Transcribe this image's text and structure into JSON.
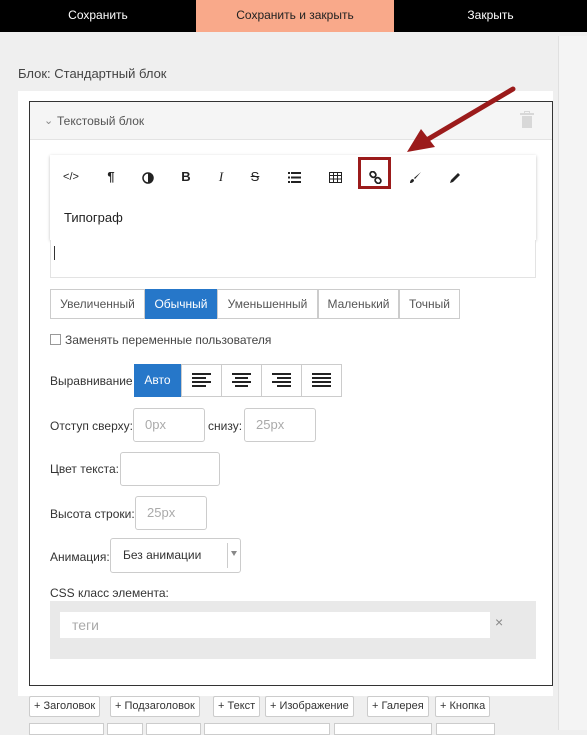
{
  "topbar": {
    "save": "Сохранить",
    "save_close": "Сохранить и закрыть",
    "close": "Закрыть"
  },
  "block_title": "Блок: Стандартный блок",
  "section": {
    "title": "Текстовый блок"
  },
  "toolbar": {
    "typograph": "Типограф",
    "buttons": [
      "code-icon",
      "paragraph-icon",
      "contrast-icon",
      "bold-icon",
      "italic-icon",
      "strikethrough-icon",
      "list-icon",
      "table-icon",
      "link-icon",
      "brush-icon",
      "pencil-icon"
    ],
    "bold": "B",
    "italic": "I",
    "strike": "S",
    "code": "</>",
    "para": "¶"
  },
  "sizes": {
    "options": [
      "Увеличенный",
      "Обычный",
      "Уменьшенный",
      "Маленький",
      "Точный"
    ],
    "selected": "Обычный"
  },
  "replace_vars": {
    "label": "Заменять переменные пользователя",
    "checked": false
  },
  "alignment": {
    "label": "Выравнивание",
    "auto": "Авто",
    "options": [
      "align-left-icon",
      "align-center-icon",
      "align-right-icon",
      "align-justify-icon"
    ]
  },
  "padding": {
    "top_label": "Отступ сверху:",
    "top_value": "0px",
    "bottom_label": "снизу:",
    "bottom_value": "25px"
  },
  "text_color": {
    "label": "Цвет текста:",
    "value": ""
  },
  "line_height": {
    "label": "Высота строки:",
    "value": "25px"
  },
  "animation": {
    "label": "Анимация:",
    "value": "Без анимации"
  },
  "css_class": {
    "label": "CSS класс элемента:",
    "placeholder": "теги",
    "clear": "×"
  },
  "add_buttons": [
    "+ Заголовок",
    "+ Подзаголовок",
    "+ Текст",
    "+ Изображение",
    "+ Галерея",
    "+ Кнопка"
  ],
  "colors": {
    "accent": "#2677c9",
    "highlight": "#9b1b1b",
    "save_close_bg": "#f9a98a"
  }
}
